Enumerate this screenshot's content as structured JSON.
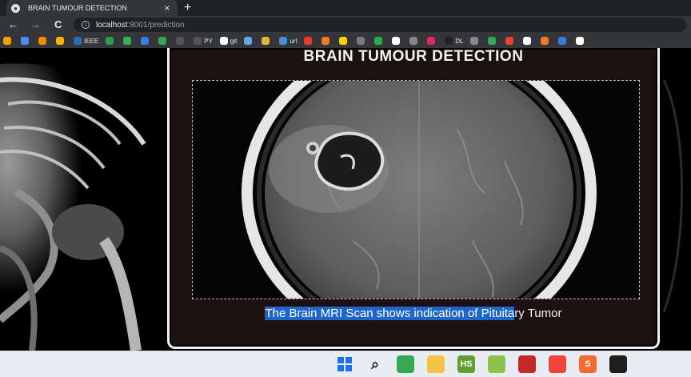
{
  "browser": {
    "tab_title": "BRAIN TUMOUR DETECTION",
    "tab_close": "×",
    "new_tab": "+",
    "nav_back": "←",
    "nav_forward": "→",
    "nav_reload": "C",
    "url_host": "localhost",
    "url_path": ":8001/prediction",
    "bookmarks": [
      {
        "label": "",
        "color": "#f4a000"
      },
      {
        "label": "",
        "color": "#4a8cff"
      },
      {
        "label": "",
        "color": "#f08a00"
      },
      {
        "label": "",
        "color": "#f7b500"
      },
      {
        "label": "IEEE",
        "color": "#2a6fb2"
      },
      {
        "label": "",
        "color": "#25a244"
      },
      {
        "label": "",
        "color": "#32b24c"
      },
      {
        "label": "",
        "color": "#3b7bde"
      },
      {
        "label": "",
        "color": "#34a853"
      },
      {
        "label": "",
        "color": "#555555"
      },
      {
        "label": "PY",
        "color": "#555555"
      },
      {
        "label": "git",
        "color": "#ffffff"
      },
      {
        "label": "",
        "color": "#6aa3e8"
      },
      {
        "label": "",
        "color": "#e3b73a"
      },
      {
        "label": "url",
        "color": "#4b89dc"
      },
      {
        "label": "",
        "color": "#e63b2e"
      },
      {
        "label": "",
        "color": "#f07b25"
      },
      {
        "label": "",
        "color": "#f6d400"
      },
      {
        "label": "",
        "color": "#7a7a7a"
      },
      {
        "label": "",
        "color": "#23b14d"
      },
      {
        "label": "",
        "color": "#ffffff"
      },
      {
        "label": "",
        "color": "#888888"
      },
      {
        "label": "",
        "color": "#e0245e"
      },
      {
        "label": "DL",
        "color": "#222222"
      },
      {
        "label": "",
        "color": "#888888"
      },
      {
        "label": "",
        "color": "#34a853"
      },
      {
        "label": "",
        "color": "#e94235"
      },
      {
        "label": "",
        "color": "#ffffff"
      },
      {
        "label": "",
        "color": "#f07b25"
      },
      {
        "label": "",
        "color": "#3b7bde"
      },
      {
        "label": "",
        "color": "#ffffff"
      }
    ]
  },
  "app": {
    "title": "BRAIN TUMOUR DETECTION",
    "result_selected": "The Brain MRI Scan shows indication of Pituita",
    "result_rest": "ry Tumor"
  },
  "taskbar": {
    "icons": [
      {
        "name": "windows-start-icon",
        "label": "",
        "color": "#1a73e8"
      },
      {
        "name": "search-icon",
        "label": "⌕",
        "color": "#e8ecf3"
      },
      {
        "name": "chrome-icon",
        "label": "",
        "color": "#34a853"
      },
      {
        "name": "file-explorer-icon",
        "label": "",
        "color": "#f6c244"
      },
      {
        "name": "app-hs-icon",
        "label": "HS",
        "color": "#5f9e2f"
      },
      {
        "name": "app-editor-icon",
        "label": "",
        "color": "#8bc34a"
      },
      {
        "name": "app-red-icon",
        "label": "",
        "color": "#c62828"
      },
      {
        "name": "anydesk-icon",
        "label": "",
        "color": "#ef443b"
      },
      {
        "name": "app-s-icon",
        "label": "S",
        "color": "#f26c30"
      },
      {
        "name": "terminal-icon",
        "label": "",
        "color": "#1e1e1e"
      }
    ]
  }
}
